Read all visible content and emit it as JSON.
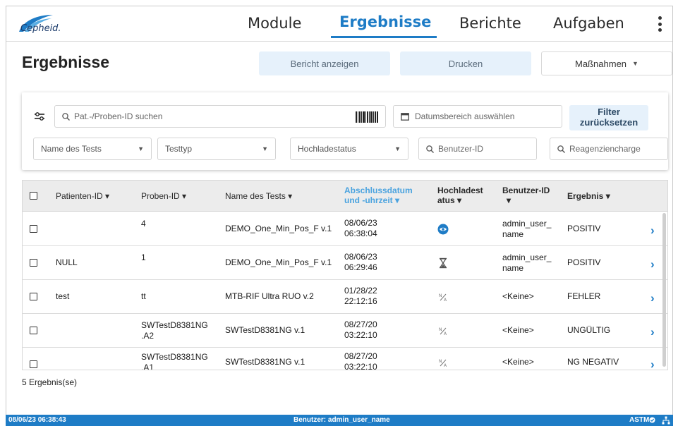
{
  "brand": {
    "logo_text": "Cepheid."
  },
  "nav": {
    "tabs": [
      {
        "label": "Module"
      },
      {
        "label": "Ergebnisse",
        "active": true
      },
      {
        "label": "Berichte"
      },
      {
        "label": "Aufgaben"
      }
    ]
  },
  "header": {
    "title": "Ergebnisse",
    "report_button": "Bericht anzeigen",
    "print_button": "Drucken",
    "actions_button": "Maßnahmen"
  },
  "filters": {
    "search_placeholder": "Pat.-/Proben-ID suchen",
    "date_placeholder": "Datumsbereich auswählen",
    "reset_line1": "Filter",
    "reset_line2": "zurücksetzen",
    "test_name": "Name des Tests",
    "test_type": "Testtyp",
    "upload_status": "Hochladestatus",
    "user_id_placeholder": "Benutzer-ID",
    "reagent_lot_placeholder": "Reagenziencharge"
  },
  "table": {
    "columns": {
      "patient_id": "Patienten-ID",
      "sample_id": "Proben-ID",
      "test_name": "Name des Tests",
      "date_line1": "Abschlussdatum",
      "date_line2": "und -uhrzeit",
      "upload_line1": "Hochladest",
      "upload_line2": "atus",
      "user_id": "Benutzer-ID",
      "result": "Ergebnis"
    },
    "rows": [
      {
        "patient": "",
        "sample1": "4",
        "sample2": "",
        "test": "DEMO_One_Min_Pos_F v.1",
        "date": "08/06/23",
        "time": "06:38:04",
        "status_icon": "eye-icon",
        "user1": "admin_user_",
        "user2": "name",
        "result": "POSITIV"
      },
      {
        "patient": "NULL",
        "sample1": "1",
        "sample2": "",
        "test": "DEMO_One_Min_Pos_F v.1",
        "date": "08/06/23",
        "time": "06:29:46",
        "status_icon": "hourglass-icon",
        "user1": "admin_user_",
        "user2": "name",
        "result": "POSITIV"
      },
      {
        "patient": "test",
        "sample1": "tt",
        "sample2": "",
        "test": "MTB-RIF Ultra RUO v.2",
        "date": "01/28/22",
        "time": "22:12:16",
        "status_icon": "not-applicable-icon",
        "user1": "<Keine>",
        "user2": "",
        "result": "FEHLER"
      },
      {
        "patient": "",
        "sample1": "SWTestD8381NG",
        "sample2": ".A2",
        "test": "SWTestD8381NG v.1",
        "date": "08/27/20",
        "time": "03:22:10",
        "status_icon": "not-applicable-icon",
        "user1": "<Keine>",
        "user2": "",
        "result": "UNGÜLTIG"
      },
      {
        "patient": "",
        "sample1": "SWTestD8381NG",
        "sample2": ".A1",
        "test": "SWTestD8381NG v.1",
        "date": "08/27/20",
        "time": "03:22:10",
        "status_icon": "not-applicable-icon",
        "user1": "<Keine>",
        "user2": "",
        "result": "NG NEGATIV"
      }
    ]
  },
  "result_count": "5 Ergebnis(se)",
  "status_bar": {
    "datetime": "08/06/23 06:38:43",
    "user": "Benutzer: admin_user_name",
    "astm": "ASTM"
  },
  "colors": {
    "accent": "#1e7cc6",
    "header_button": "#e6f1fb",
    "sort_active": "#4aa3df"
  }
}
